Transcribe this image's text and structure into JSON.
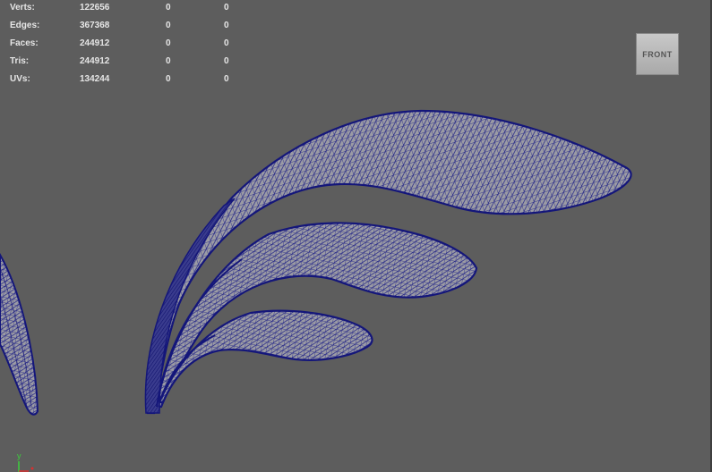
{
  "hud": {
    "rows": [
      {
        "label": "Verts:",
        "total": "122656",
        "selected": "0",
        "selected2": "0"
      },
      {
        "label": "Edges:",
        "total": "367368",
        "selected": "0",
        "selected2": "0"
      },
      {
        "label": "Faces:",
        "total": "244912",
        "selected": "0",
        "selected2": "0"
      },
      {
        "label": "Tris:",
        "total": "244912",
        "selected": "0",
        "selected2": "0"
      },
      {
        "label": "UVs:",
        "total": "134244",
        "selected": "0",
        "selected2": "0"
      }
    ]
  },
  "view_cube": {
    "label": "FRONT"
  },
  "axis": {
    "y_label": "y"
  },
  "colors": {
    "background": "#5d5d5d",
    "wireframe": "#14167a",
    "surface": "#9a9aa2",
    "hud_text": "#e6e6e6"
  }
}
